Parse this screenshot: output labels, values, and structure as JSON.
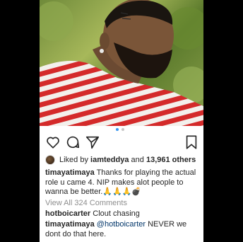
{
  "liked": {
    "prefix": "Liked by",
    "user": "iamteddya",
    "and": "and",
    "count": "13,961 others"
  },
  "caption": {
    "user": "timayatimaya",
    "text": "Thanks for playing the actual role u came 4. NIP  makes alot people to wanna be better.🙏🙏🙏💣"
  },
  "view_all": "View All 324 Comments",
  "comments": [
    {
      "user": "hotboicarter",
      "text": "Clout chasing"
    },
    {
      "user": "timayatimaya",
      "mention": "@hotboicarter",
      "text": "NEVER we dont do that here."
    }
  ],
  "icons": [
    "heart-icon",
    "comment-icon",
    "share-icon",
    "bookmark-icon"
  ],
  "colors": {
    "background": "#000000",
    "text": "#262626",
    "muted": "#8e8e8e",
    "mention": "#003569"
  }
}
